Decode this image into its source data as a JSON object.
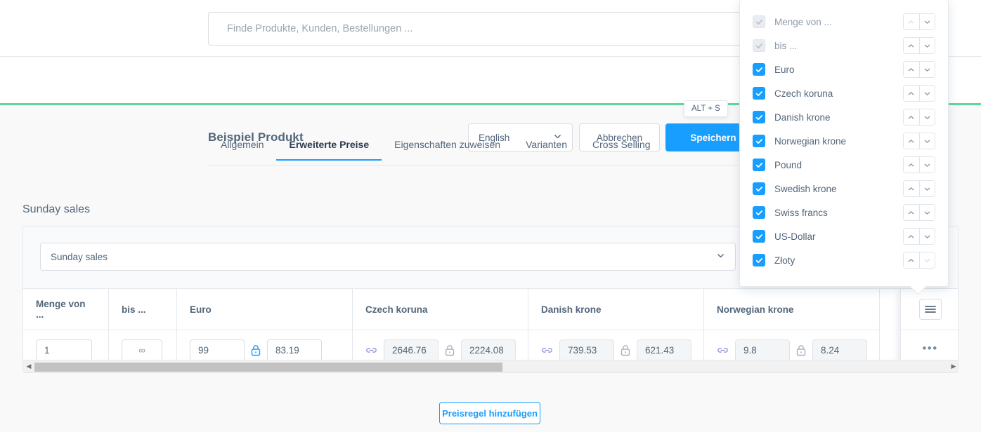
{
  "search": {
    "placeholder": "Finde Produkte, Kunden, Bestellungen ...",
    "value": ""
  },
  "smartbar": {
    "title": "Beispiel Produkt",
    "language": "English",
    "cancel_label": "Abbrechen",
    "save_label": "Speichern",
    "save_tooltip": "ALT + S"
  },
  "tabs": [
    {
      "label": "Allgemein",
      "active": false
    },
    {
      "label": "Erweiterte Preise",
      "active": true
    },
    {
      "label": "Eigenschaften zuweisen",
      "active": false
    },
    {
      "label": "Varianten",
      "active": false
    },
    {
      "label": "Cross Selling",
      "active": false
    }
  ],
  "section": {
    "title": "Sunday sales",
    "rule_select_value": "Sunday sales"
  },
  "table": {
    "columns": [
      "Menge von ...",
      "bis ...",
      "Euro",
      "Czech koruna",
      "Danish krone",
      "Norwegian krone"
    ],
    "row": {
      "quantity_start": "1",
      "quantity_end": "∞",
      "euro_gross": "99",
      "euro_net": "83.19",
      "czech_gross": "2646.76",
      "czech_net": "2224.08",
      "danish_gross": "739.53",
      "danish_net": "621.43",
      "norwegian_gross": "9.8",
      "norwegian_net": "8.24"
    }
  },
  "footer": {
    "add_rule_label": "Preisregel hinzufügen"
  },
  "columns_dropdown": {
    "items": [
      {
        "label": "Menge von ...",
        "checked": false,
        "disabled": true,
        "up_disabled": true,
        "down_disabled": false
      },
      {
        "label": "bis ...",
        "checked": false,
        "disabled": true,
        "up_disabled": false,
        "down_disabled": false
      },
      {
        "label": "Euro",
        "checked": true,
        "disabled": false,
        "up_disabled": false,
        "down_disabled": false
      },
      {
        "label": "Czech koruna",
        "checked": true,
        "disabled": false,
        "up_disabled": false,
        "down_disabled": false
      },
      {
        "label": "Danish krone",
        "checked": true,
        "disabled": false,
        "up_disabled": false,
        "down_disabled": false
      },
      {
        "label": "Norwegian krone",
        "checked": true,
        "disabled": false,
        "up_disabled": false,
        "down_disabled": false
      },
      {
        "label": "Pound",
        "checked": true,
        "disabled": false,
        "up_disabled": false,
        "down_disabled": false
      },
      {
        "label": "Swedish krone",
        "checked": true,
        "disabled": false,
        "up_disabled": false,
        "down_disabled": false
      },
      {
        "label": "Swiss francs",
        "checked": true,
        "disabled": false,
        "up_disabled": false,
        "down_disabled": false
      },
      {
        "label": "US-Dollar",
        "checked": true,
        "disabled": false,
        "up_disabled": false,
        "down_disabled": false
      },
      {
        "label": "Złoty",
        "checked": true,
        "disabled": false,
        "up_disabled": false,
        "down_disabled": true
      }
    ]
  },
  "colors": {
    "accent": "#189eff",
    "green_bar": "#5bd999",
    "text": "#52667a",
    "link_icon": "#8b8fd6"
  }
}
